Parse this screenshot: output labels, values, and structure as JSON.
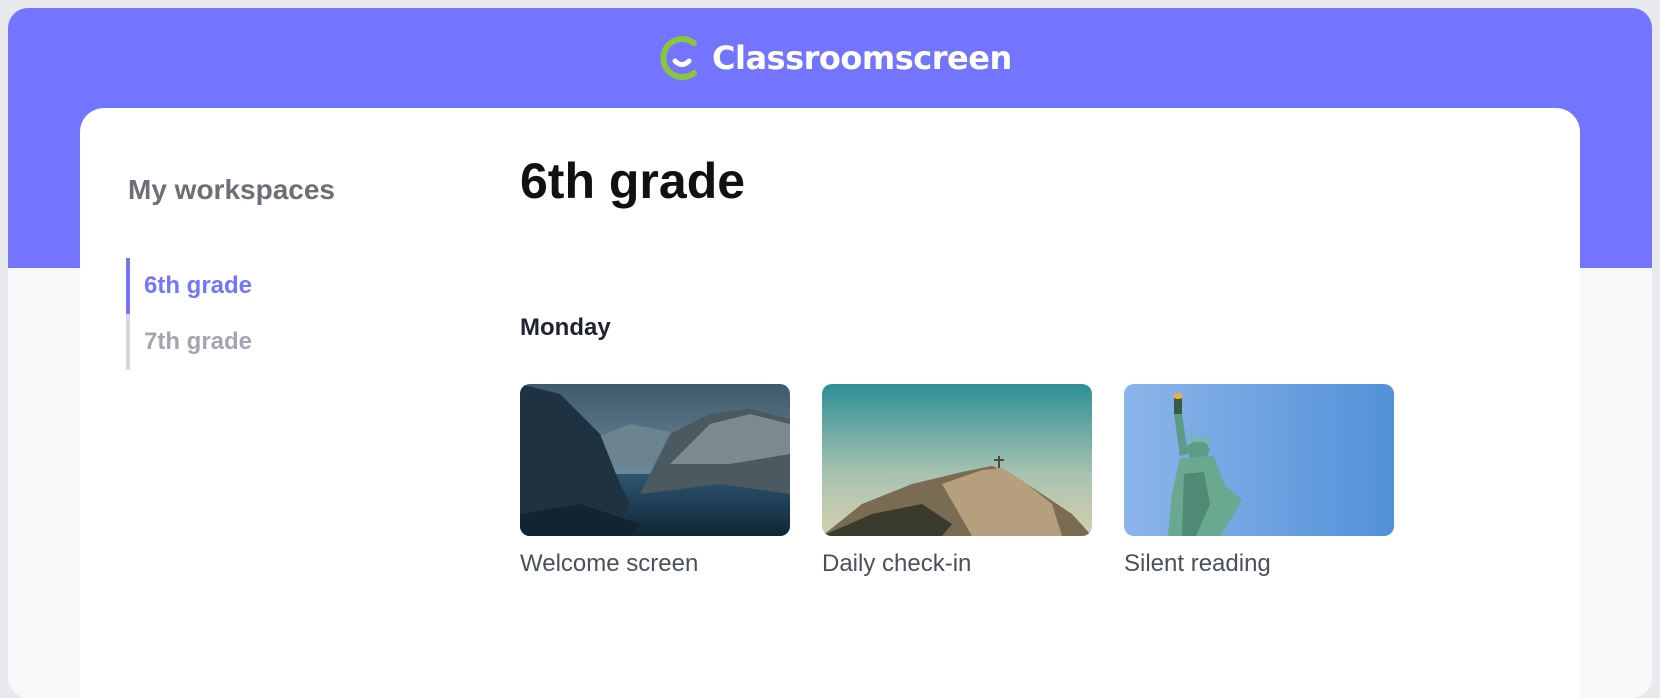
{
  "header": {
    "brand_name": "Classroomscreen",
    "logo_icon": "classroomscreen-logo-icon",
    "banner_color": "#7375fe",
    "accent_color": "#8bc53f"
  },
  "sidebar": {
    "title": "My workspaces",
    "items": [
      {
        "label": "6th grade",
        "active": true
      },
      {
        "label": "7th grade",
        "active": false
      }
    ]
  },
  "main": {
    "title": "6th grade",
    "sections": [
      {
        "heading": "Monday",
        "screens": [
          {
            "label": "Welcome screen",
            "thumbnail": "fjord-landscape-image"
          },
          {
            "label": "Daily check-in",
            "thumbnail": "mountain-statue-image"
          },
          {
            "label": "Silent reading",
            "thumbnail": "statue-of-liberty-image"
          }
        ]
      }
    ]
  }
}
